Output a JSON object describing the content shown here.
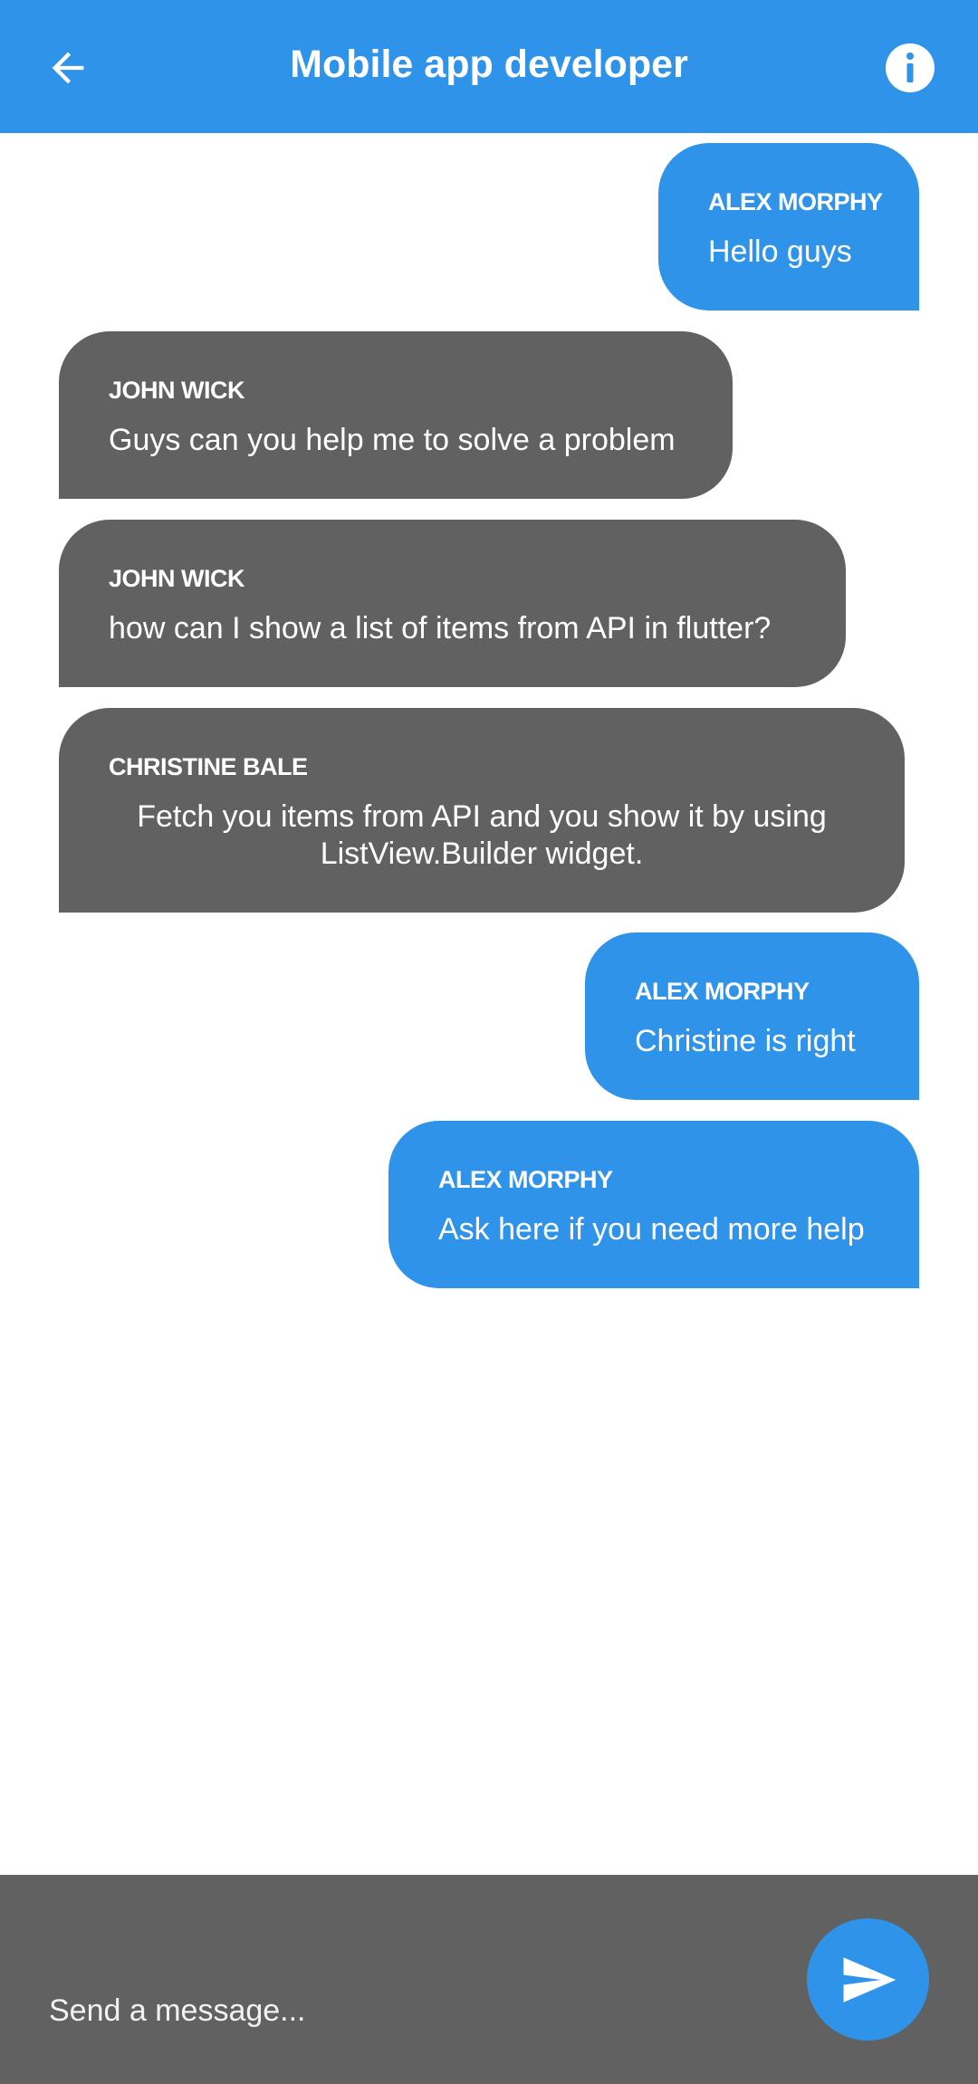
{
  "header": {
    "title": "Mobile app developer",
    "back_icon": "arrow-left-icon",
    "info_icon": "info-icon",
    "color": "#2f93e9"
  },
  "messages": [
    {
      "sender": "ALEX MORPHY",
      "text": "Hello guys",
      "mine": true
    },
    {
      "sender": "JOHN WICK",
      "text": "Guys can you help me to solve a problem",
      "mine": false
    },
    {
      "sender": "JOHN WICK",
      "text": "how can I show a list of items from API in flutter?",
      "mine": false
    },
    {
      "sender": "CHRISTINE BALE",
      "text": "Fetch you items from API and you show it by using ListView.Builder widget.",
      "mine": false
    },
    {
      "sender": "ALEX MORPHY",
      "text": "Christine is right",
      "mine": true
    },
    {
      "sender": "ALEX MORPHY",
      "text": "Ask here if you need more help",
      "mine": true
    }
  ],
  "composer": {
    "placeholder": "Send a message...",
    "send_icon": "send-icon"
  },
  "colors": {
    "mine_bubble": "#2f93e9",
    "other_bubble": "#616161"
  }
}
